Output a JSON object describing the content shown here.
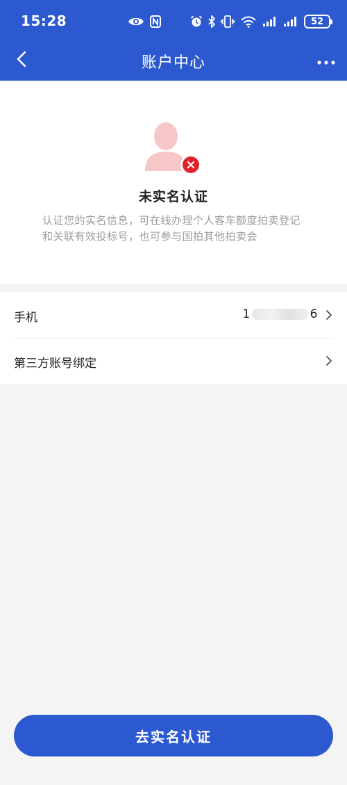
{
  "status_bar": {
    "time": "15:28",
    "battery": "52",
    "icons": [
      "eye-icon",
      "nfc-icon",
      "alarm-icon",
      "bluetooth-icon",
      "vibrate-icon",
      "wifi-icon",
      "signal-icon",
      "signal-icon",
      "battery-icon"
    ]
  },
  "nav": {
    "title": "账户中心",
    "back_icon": "chevron-left-icon",
    "more_icon": "more-dots-icon"
  },
  "profile": {
    "avatar_icon": "user-avatar-icon",
    "badge_icon": "close-x-icon",
    "status_title": "未实名认证",
    "description": "认证您的实名信息，可在线办理个人客车额度拍卖登记和关联有效投标号，也可参与国拍其他拍卖会"
  },
  "list": {
    "phone_label": "手机",
    "phone_prefix": "1",
    "phone_suffix": "6",
    "bind_label": "第三方账号绑定"
  },
  "cta": {
    "label": "去实名认证"
  },
  "colors": {
    "brand_blue": "#2c59cf",
    "error_red": "#e0242b",
    "avatar_pink": "#f7c6c6"
  }
}
